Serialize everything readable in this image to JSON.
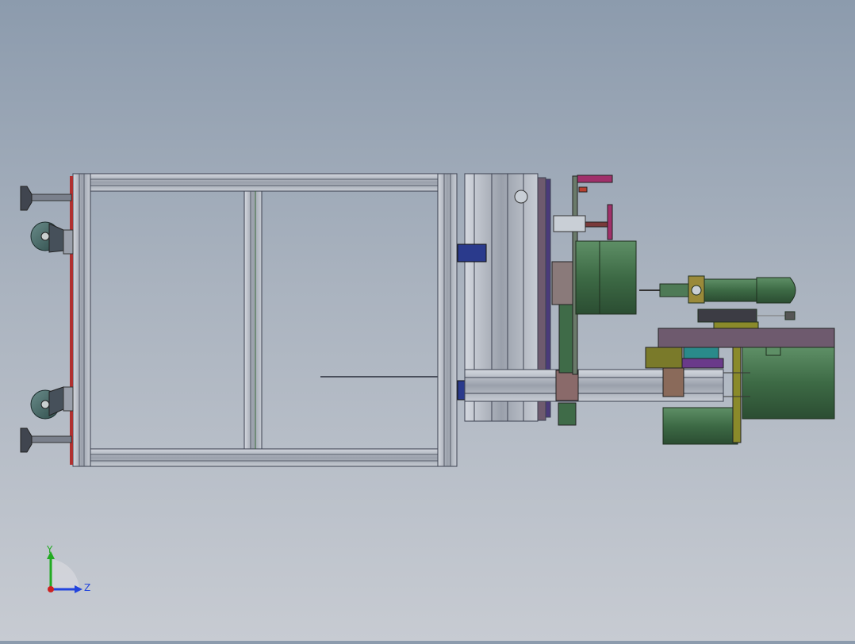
{
  "viewport": {
    "background_top": "#8c9bad",
    "background_bottom": "#c7cbd2"
  },
  "colors": {
    "frame_steel": "#b9bec8",
    "frame_edge": "#3c4150",
    "machine_green": "#3f6b48",
    "dark_green": "#2f5236",
    "purple_plate": "#6e5a6e",
    "blue_bracket": "#2a3a8c",
    "magenta_cylinder": "#a0306a",
    "olive": "#7a7a2a",
    "red_foot": "#b03030"
  },
  "triad": {
    "y_label": "Y",
    "z_label": "Z",
    "y_color": "#22aa22",
    "z_color": "#2244dd",
    "origin_color": "#cc2222"
  }
}
